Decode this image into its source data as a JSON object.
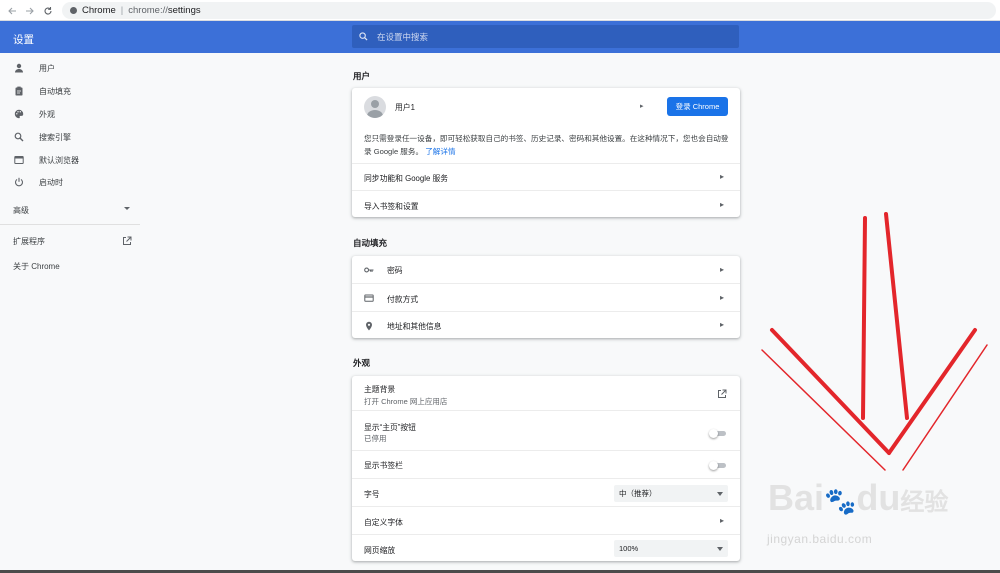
{
  "browser": {
    "tab_label": "Chrome",
    "url_host": "chrome://",
    "url_path": "settings"
  },
  "header": {
    "title": "设置",
    "search_placeholder": "在设置中搜索"
  },
  "sidebar": {
    "items": [
      {
        "label": "用户",
        "icon": "person-icon"
      },
      {
        "label": "自动填充",
        "icon": "clipboard-icon"
      },
      {
        "label": "外观",
        "icon": "palette-icon"
      },
      {
        "label": "搜索引擎",
        "icon": "search-icon"
      },
      {
        "label": "默认浏览器",
        "icon": "browser-window-icon"
      },
      {
        "label": "启动时",
        "icon": "power-icon"
      }
    ],
    "advanced": "高级",
    "extensions": "扩展程序",
    "about": "关于 Chrome"
  },
  "people": {
    "section_title": "用户",
    "user_name": "用户1",
    "signin_button": "登录 Chrome",
    "description": "您只需登录任一设备，即可轻松获取自己的书签、历史记录、密码和其他设置。在这种情况下，您也会自动登录 Google 服务。",
    "learn_more": "了解详情",
    "sync_label": "同步功能和 Google 服务",
    "import_label": "导入书签和设置"
  },
  "autofill": {
    "section_title": "自动填充",
    "items": [
      {
        "label": "密码",
        "icon": "key-icon"
      },
      {
        "label": "付款方式",
        "icon": "credit-card-icon"
      },
      {
        "label": "地址和其他信息",
        "icon": "location-pin-icon"
      }
    ]
  },
  "appearance": {
    "section_title": "外观",
    "theme_label": "主题背景",
    "theme_sub": "打开 Chrome 网上应用店",
    "home_button_label": "显示“主页”按钮",
    "home_button_sub": "已停用",
    "bookmarks_bar_label": "显示书签栏",
    "font_size_label": "字号",
    "font_size_value": "中（推荐）",
    "custom_fonts_label": "自定义字体",
    "zoom_label": "网页缩放",
    "zoom_value": "100%"
  },
  "watermark": {
    "logo": "Bai",
    "logo2": "du",
    "logo_cn": "经验",
    "url": "jingyan.baidu.com"
  },
  "colors": {
    "header_blue": "#3c70d8",
    "primary_button": "#1a73e8",
    "annotation_red": "#e3262b"
  }
}
